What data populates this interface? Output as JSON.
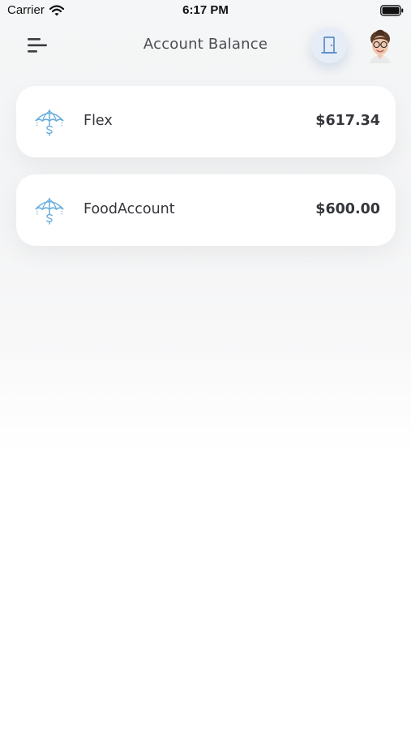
{
  "status_bar": {
    "carrier": "Carrier",
    "time": "6:17 PM",
    "icons": [
      "wifi-icon",
      "battery-icon"
    ]
  },
  "header": {
    "title": "Account Balance",
    "menu_icon": "menu-icon",
    "logout_icon": "door-icon",
    "avatar": "user-avatar"
  },
  "accounts": [
    {
      "name": "Flex",
      "balance": "$617.34",
      "icon": "umbrella-dollar-icon"
    },
    {
      "name": "FoodAccount",
      "balance": "$600.00",
      "icon": "umbrella-dollar-icon"
    }
  ],
  "colors": {
    "accent": "#6aaedf",
    "logout_bg": "#e7edf6",
    "text": "#34363b",
    "card": "#ffffff",
    "background": "#f4f5f6"
  }
}
